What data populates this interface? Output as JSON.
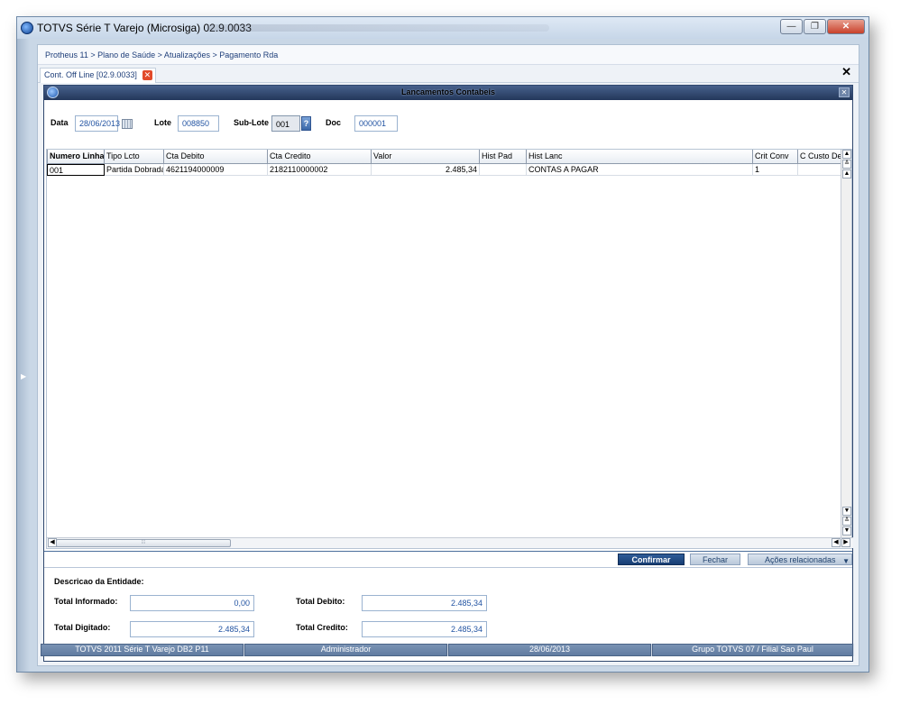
{
  "window": {
    "title": "TOTVS Série T Varejo (Microsiga) 02.9.0033",
    "controls": [
      "minimize-icon",
      "restore-icon",
      "close-icon"
    ]
  },
  "breadcrumb": "Protheus 11 > Plano de Saúde > Atualizações > Pagamento Rda",
  "tab": {
    "label": "Cont. Off Line [02.9.0033]"
  },
  "dialog": {
    "title": "Lancamentos Contabeis",
    "fields": {
      "data_label": "Data",
      "data_value": "28/06/2013",
      "lote_label": "Lote",
      "lote_value": "008850",
      "sublote_label": "Sub-Lote",
      "sublote_value": "001",
      "lookup_label": "?",
      "doc_label": "Doc",
      "doc_value": "000001"
    },
    "grid": {
      "columns": [
        "Numero Linha",
        "Tipo Lcto",
        "Cta Debito",
        "Cta Credito",
        "Valor",
        "Hist Pad",
        "Hist Lanc",
        "Crit Conv",
        "C Custo Deb"
      ],
      "rows": [
        [
          "001",
          "Partida Dobrada",
          "4621194000009",
          "2182110000002",
          "2.485,34",
          "",
          "CONTAS A PAGAR",
          "1",
          ""
        ]
      ]
    },
    "buttons": {
      "confirm": "Confirmar",
      "close": "Fechar",
      "actions": "Ações relacionadas"
    },
    "summary": {
      "descricao_label": "Descricao da Entidade:",
      "total_informado_label": "Total Informado:",
      "total_informado_value": "0,00",
      "total_digitado_label": "Total Digitado:",
      "total_digitado_value": "2.485,34",
      "total_debito_label": "Total Debito:",
      "total_debito_value": "2.485,34",
      "total_credito_label": "Total Credito:",
      "total_credito_value": "2.485,34"
    }
  },
  "statusbar": [
    "TOTVS 2011 Série T Varejo DB2 P11",
    "Administrador",
    "28/06/2013",
    "Grupo TOTVS 07 / Filial Sao Paul"
  ]
}
